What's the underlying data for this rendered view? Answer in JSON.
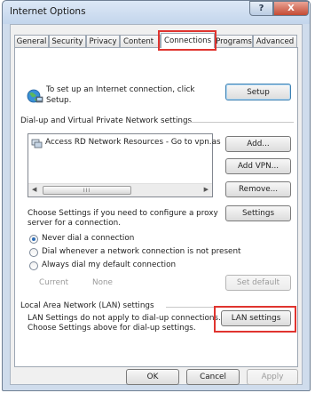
{
  "window": {
    "title": "Internet Options",
    "help_glyph": "?",
    "close_glyph": "X"
  },
  "tabs": [
    {
      "label": "General"
    },
    {
      "label": "Security"
    },
    {
      "label": "Privacy"
    },
    {
      "label": "Content"
    },
    {
      "label": "Connections",
      "active": true
    },
    {
      "label": "Programs"
    },
    {
      "label": "Advanced"
    }
  ],
  "setup": {
    "text_line1": "To set up an Internet connection, click",
    "text_line2": "Setup.",
    "button": "Setup"
  },
  "dialup": {
    "group_label": "Dial-up and Virtual Private Network settings",
    "items": [
      "Access RD Network Resources - Go to vpn.as"
    ],
    "scroll_grip": "III",
    "add_button": "Add...",
    "add_vpn_button": "Add VPN...",
    "remove_button": "Remove...",
    "settings_text_line1": "Choose Settings if you need to configure a proxy",
    "settings_text_line2": "server for a connection.",
    "settings_button": "Settings",
    "options": [
      {
        "label": "Never dial a connection",
        "selected": true
      },
      {
        "label": "Dial whenever a network connection is not present",
        "selected": false
      },
      {
        "label": "Always dial my default connection",
        "selected": false
      }
    ],
    "current_label": "Current",
    "current_value": "None",
    "set_default_button": "Set default"
  },
  "lan": {
    "group_label": "Local Area Network (LAN) settings",
    "text_line1": "LAN Settings do not apply to dial-up connections.",
    "text_line2": "Choose Settings above for dial-up settings.",
    "button": "LAN settings"
  },
  "footer": {
    "ok": "OK",
    "cancel": "Cancel",
    "apply": "Apply"
  },
  "colors": {
    "highlight_box": "#e0342f",
    "radio_dot": "#2f6fb7"
  }
}
